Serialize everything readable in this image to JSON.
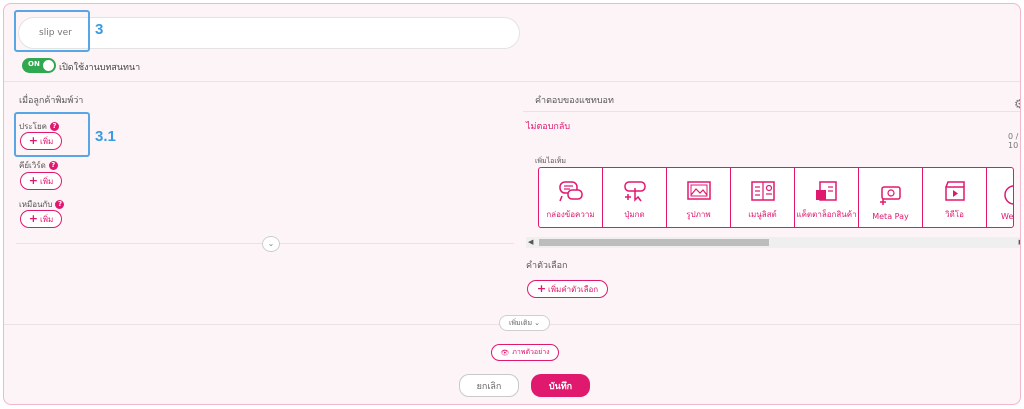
{
  "form": {
    "name_input": {
      "value": "",
      "placeholder": "slip ver"
    },
    "toggle": {
      "state_label": "ON",
      "label": "เปิดใช้งานบทสนทนา"
    }
  },
  "annotations": {
    "box1": "3",
    "box2": "3.1"
  },
  "left_panel": {
    "title": "เมื่อลูกค้าพิมพ์ว่า",
    "groups": [
      {
        "label": "ประโยค",
        "button": "เพิ่ม"
      },
      {
        "label": "คีย์เวิร์ด",
        "button": "เพิ่ม"
      },
      {
        "label": "เหมือนกับ",
        "button": "เพิ่ม"
      }
    ],
    "help_icon": "?"
  },
  "right_panel": {
    "title": "คำตอบของแชทบอท",
    "no_reply": "ไม่ตอบกลับ",
    "counter": "0 / 10",
    "add_item_label": "เพิ่มไอเท็ม",
    "cards": [
      {
        "label": "กล่องข้อความ",
        "icon": "chat-bubble-icon"
      },
      {
        "label": "ปุ่มกด",
        "icon": "button-click-icon"
      },
      {
        "label": "รูปภาพ",
        "icon": "image-icon"
      },
      {
        "label": "เมนูลิสต์",
        "icon": "menu-list-icon"
      },
      {
        "label": "แค็ตตาล็อกสินค้า",
        "icon": "catalog-icon"
      },
      {
        "label": "Meta Pay",
        "icon": "meta-pay-icon"
      },
      {
        "label": "วิดีโอ",
        "icon": "video-icon"
      },
      {
        "label": "Web",
        "icon": "web-icon"
      }
    ],
    "options_title": "คำตัวเลือก",
    "add_option_button": "เพิ่มคำตัวเลือก"
  },
  "footer": {
    "more_button": "เพิ่มเติม",
    "preview_button": "ภาพตัวอย่าง",
    "cancel_button": "ยกเลิก",
    "save_button": "บันทึก"
  },
  "colors": {
    "accent": "#e0196e",
    "highlight": "#58a6e6",
    "toggle_on": "#2fa84f",
    "background": "#fdf4f7"
  }
}
